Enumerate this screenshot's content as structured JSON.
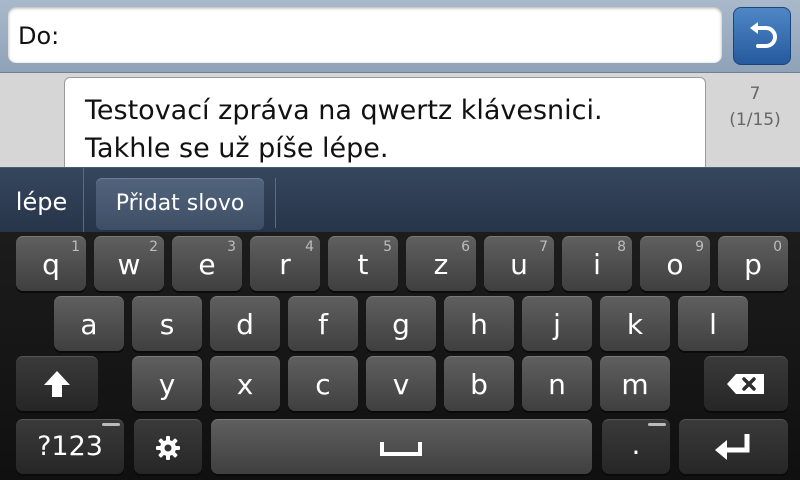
{
  "header": {
    "to_label": "Do:",
    "to_value": ""
  },
  "message": {
    "line1": "Testovací zpráva na qwertz klávesnici.",
    "line2": "Takhle se už píše lépe.",
    "counter_top": "7",
    "counter_bottom": "(1/15)"
  },
  "suggestions": {
    "word": "lépe",
    "add_word": "Přidat slovo"
  },
  "keyboard": {
    "row1": [
      {
        "label": "q",
        "hint": "1"
      },
      {
        "label": "w",
        "hint": "2"
      },
      {
        "label": "e",
        "hint": "3"
      },
      {
        "label": "r",
        "hint": "4"
      },
      {
        "label": "t",
        "hint": "5"
      },
      {
        "label": "z",
        "hint": "6"
      },
      {
        "label": "u",
        "hint": "7"
      },
      {
        "label": "i",
        "hint": "8"
      },
      {
        "label": "o",
        "hint": "9"
      },
      {
        "label": "p",
        "hint": "0"
      }
    ],
    "row2": [
      "a",
      "s",
      "d",
      "f",
      "g",
      "h",
      "j",
      "k",
      "l"
    ],
    "row3": [
      "y",
      "x",
      "c",
      "v",
      "b",
      "n",
      "m"
    ],
    "symbols_label": "?123",
    "period_label": ".",
    "icons": {
      "back": "undo-arrow-icon",
      "shift": "shift-arrow-icon",
      "backspace": "backspace-icon",
      "settings": "gear-icon",
      "space": "space-bar-icon",
      "enter": "enter-return-icon"
    }
  }
}
